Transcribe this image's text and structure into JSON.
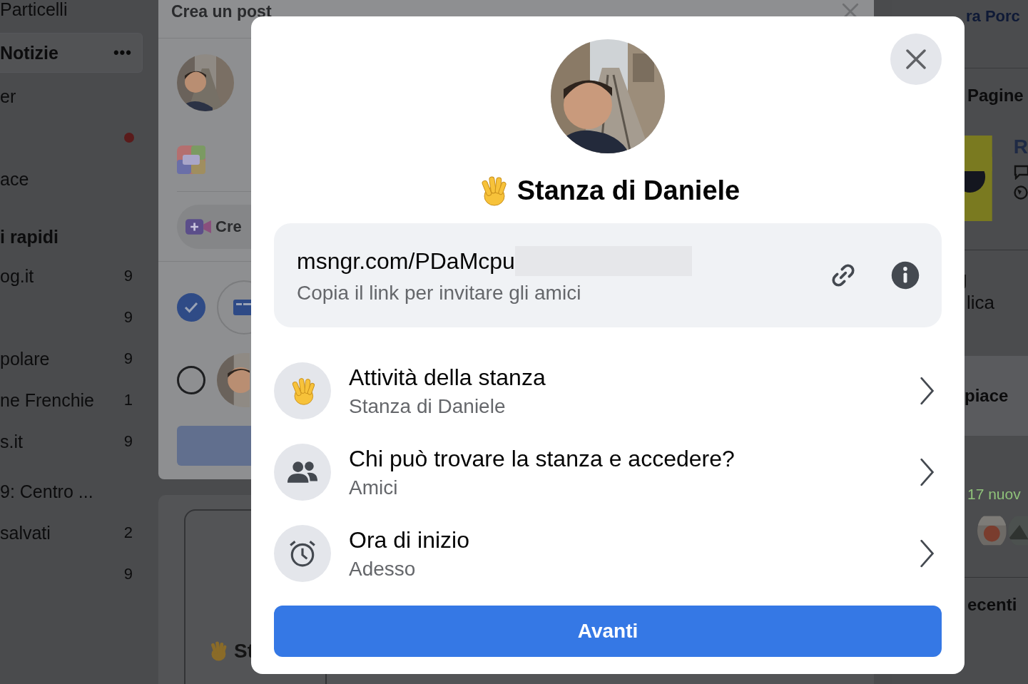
{
  "sidebar": {
    "groups": [
      {
        "items": [
          {
            "kind": "link",
            "label": "Particelli",
            "selected": false
          },
          {
            "kind": "link",
            "label": "Notizie",
            "more": "•••",
            "selected": true
          },
          {
            "kind": "link",
            "label": "er",
            "selected": false
          },
          {
            "kind": "dot",
            "selected": false
          },
          {
            "kind": "link",
            "label": "ace",
            "selected": false
          }
        ]
      },
      {
        "title": "i rapidi",
        "items": [
          {
            "kind": "link",
            "label": "og.it",
            "count": "9",
            "selected": false
          },
          {
            "kind": "link",
            "count": "9",
            "selected": false
          },
          {
            "kind": "link",
            "label": "polare",
            "count": "9",
            "selected": false
          },
          {
            "kind": "link",
            "label": "ne Frenchie",
            "count": "1",
            "selected": false
          },
          {
            "kind": "link",
            "label": "s.it",
            "count": "9",
            "selected": false
          }
        ]
      },
      {
        "items": [
          {
            "kind": "link",
            "label": "9: Centro ...",
            "selected": false
          },
          {
            "kind": "link",
            "label": "salvati",
            "count": "2",
            "selected": false
          },
          {
            "kind": "link",
            "count": "9",
            "selected": false
          }
        ]
      }
    ]
  },
  "post_dialog": {
    "title": "Crea un post",
    "create_button": "Cre",
    "options": [
      {
        "kind": "page",
        "checked": true
      },
      {
        "kind": "profile",
        "checked": false
      }
    ]
  },
  "room_card": {
    "title": "St"
  },
  "right_column": {
    "contact": "ra Porc",
    "pages_title": "Pagine",
    "page_name": "R",
    "action": "lica",
    "likes_title": "piace",
    "new_count": "17 nuov",
    "recent_title": "ecenti"
  },
  "modal": {
    "title": "Stanza di Daniele",
    "link": {
      "url": "msngr.com/PDaMcpu",
      "hint": "Copia il link per invitare gli amici"
    },
    "settings": [
      {
        "kind": "activity",
        "title": "Attività della stanza",
        "value": "Stanza di Daniele"
      },
      {
        "kind": "audience",
        "title": "Chi può trovare la stanza e accedere?",
        "value": "Amici"
      },
      {
        "kind": "start_time",
        "title": "Ora di inizio",
        "value": "Adesso"
      }
    ],
    "primary_button": "Avanti"
  }
}
